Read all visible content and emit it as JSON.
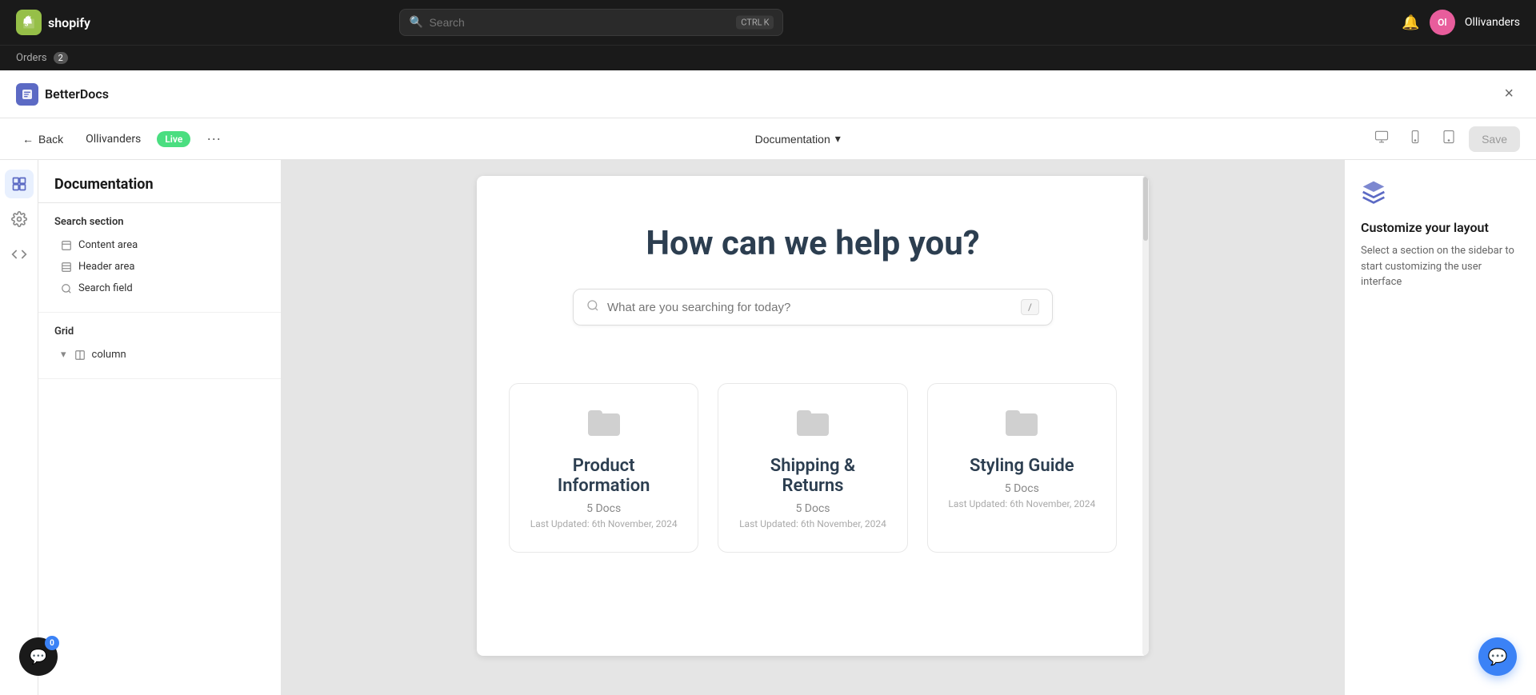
{
  "shopify_bar": {
    "logo_text": "shopify",
    "search_placeholder": "Search",
    "search_shortcut": [
      "CTRL",
      "K"
    ],
    "bell_icon": "🔔",
    "avatar_initials": "Ol",
    "store_name": "Ollivanders"
  },
  "orders_bar": {
    "label": "Orders",
    "count": "2"
  },
  "modal": {
    "app_name": "BetterDocs",
    "close_icon": "×"
  },
  "toolbar": {
    "back_label": "Back",
    "store_label": "Ollivanders",
    "live_label": "Live",
    "more_icon": "···",
    "doc_selector_label": "Documentation",
    "desktop_icon": "🖥",
    "mobile_icon": "📱",
    "tablet_icon": "⊞",
    "save_label": "Save"
  },
  "sidebar": {
    "title": "Documentation",
    "search_section_label": "Search section",
    "items": [
      {
        "icon": "content",
        "label": "Content area"
      },
      {
        "icon": "header",
        "label": "Header area"
      },
      {
        "icon": "search",
        "label": "Search field"
      }
    ],
    "grid_section_label": "Grid",
    "grid_items": [
      {
        "icon": "column",
        "label": "column"
      }
    ]
  },
  "preview": {
    "hero_title": "How can we help you?",
    "search_placeholder": "What are you searching for today?",
    "search_hint": "/",
    "cards": [
      {
        "title": "Product Information",
        "count": "5 Docs",
        "date": "Last Updated: 6th November, 2024"
      },
      {
        "title": "Shipping & Returns",
        "count": "5 Docs",
        "date": "Last Updated: 6th November, 2024"
      },
      {
        "title": "Styling Guide",
        "count": "5 Docs",
        "date": "Last Updated: 6th November, 2024"
      }
    ]
  },
  "right_panel": {
    "title": "Customize your layout",
    "desc": "Select a section on the sidebar to start customizing the user interface"
  },
  "nav_icons": [
    {
      "name": "sections",
      "icon": "⊞"
    },
    {
      "name": "settings",
      "icon": "⚙"
    },
    {
      "name": "code",
      "icon": "</>"
    }
  ],
  "chat_widget": {
    "icon": "💬"
  },
  "notif_widget": {
    "icon": "💬",
    "badge": "0"
  }
}
